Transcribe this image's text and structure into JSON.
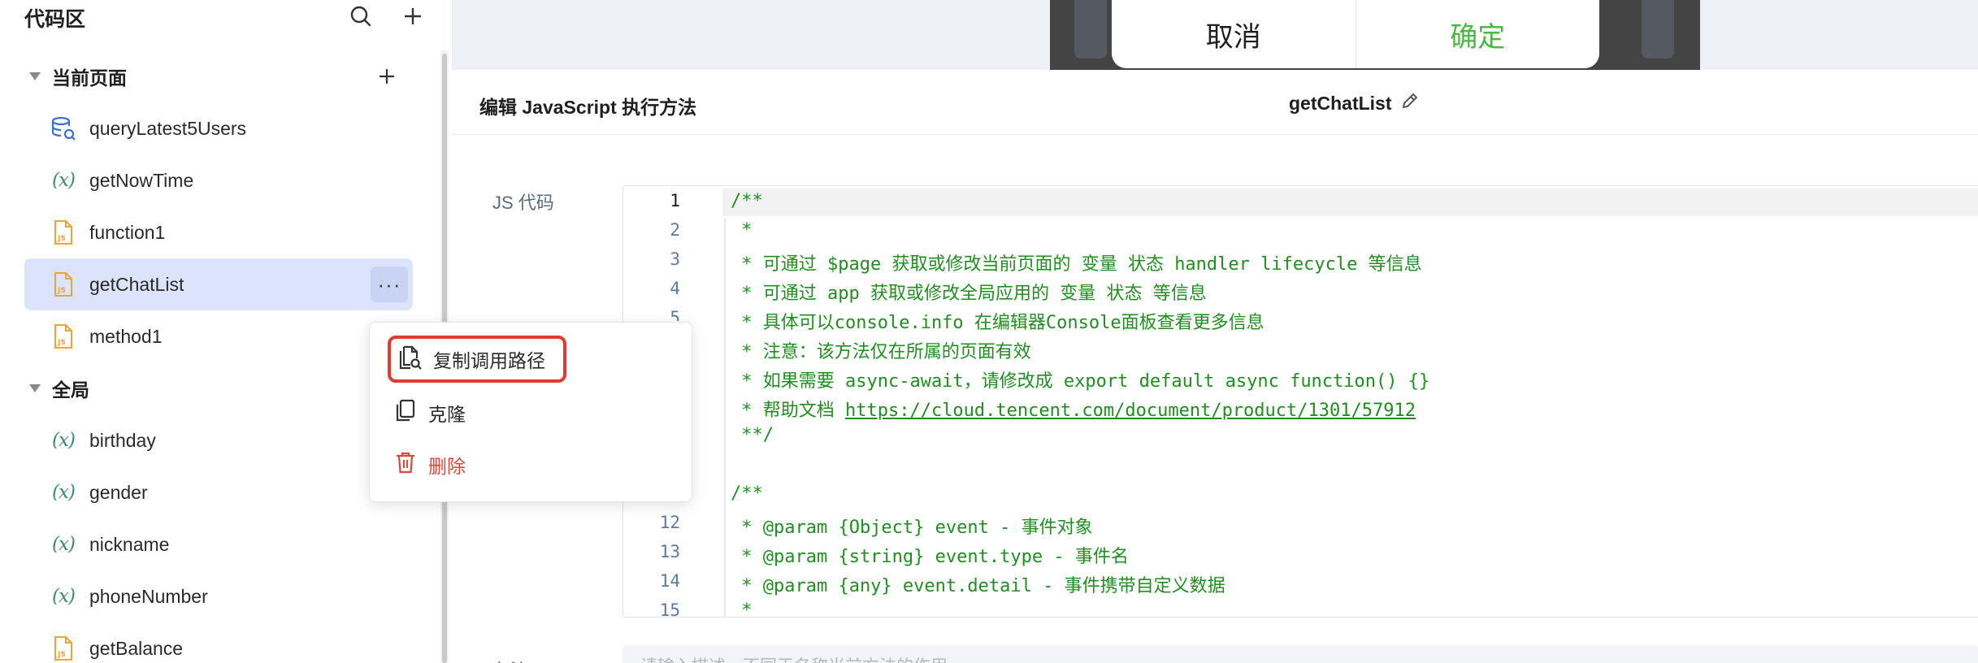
{
  "sidebar": {
    "title": "代码区",
    "groups": [
      {
        "label": "当前页面"
      },
      {
        "label": "全局"
      }
    ],
    "page_items": [
      {
        "label": "queryLatest5Users",
        "icon": "database-query-icon"
      },
      {
        "label": "getNowTime",
        "icon": "variable-icon"
      },
      {
        "label": "function1",
        "icon": "js-file-icon"
      },
      {
        "label": "getChatList",
        "icon": "js-file-icon",
        "selected": true
      },
      {
        "label": "method1",
        "icon": "js-file-icon"
      }
    ],
    "global_items": [
      {
        "label": "birthday",
        "icon": "variable-icon"
      },
      {
        "label": "gender",
        "icon": "variable-icon"
      },
      {
        "label": "nickname",
        "icon": "variable-icon"
      },
      {
        "label": "phoneNumber",
        "icon": "variable-icon"
      },
      {
        "label": "getBalance",
        "icon": "js-file-icon"
      }
    ],
    "more_glyph": "···",
    "variable_glyph": "(x)"
  },
  "context_menu": {
    "items": [
      {
        "label": "复制调用路径",
        "icon": "copy-path-icon"
      },
      {
        "label": "克隆",
        "icon": "clone-icon"
      },
      {
        "label": "删除",
        "icon": "trash-icon"
      }
    ]
  },
  "dialog": {
    "cancel_label": "取消",
    "confirm_label": "确定"
  },
  "editor": {
    "title": "编辑 JavaScript 执行方法",
    "function_name": "getChatList",
    "code_label": "JS 代码",
    "line_numbers": [
      "1",
      "2",
      "3",
      "4",
      "5",
      "12",
      "13",
      "14",
      "15"
    ],
    "lines": [
      "/**",
      " *",
      " * 可通过 $page 获取或修改当前页面的 变量 状态 handler lifecycle 等信息",
      " * 可通过 app 获取或修改全局应用的 变量 状态 等信息",
      " * 具体可以console.info 在编辑器Console面板查看更多信息",
      " * 注意：该方法仅在所属的页面有效",
      " * 如果需要 async-await，请修改成 export default async function() {}",
      " * 帮助文档 ",
      " **/",
      "",
      "/**",
      " * @param {Object} event - 事件对象",
      " * @param {string} event.type - 事件名",
      " * @param {any} event.detail - 事件携带自定义数据",
      " *"
    ],
    "help_link": "https://cloud.tencent.com/document/product/1301/57912",
    "remark_label": "备注",
    "remark_placeholder": "请输入描述，不同于名称当前方法的作用"
  },
  "colors": {
    "accent_selected": "#dce4fb",
    "confirm_green": "#49b842",
    "danger_red": "#e0473b",
    "highlight_border": "#e23b2e",
    "code_green": "#1f8f1f",
    "js_icon_orange": "#e8a53a",
    "var_icon_green": "#3d8c68",
    "db_icon_blue": "#3b6fd9"
  }
}
